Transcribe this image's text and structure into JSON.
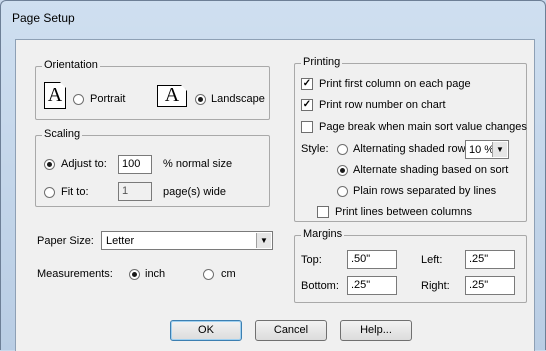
{
  "window": {
    "title": "Page Setup"
  },
  "orientation": {
    "legend": "Orientation",
    "portrait_label": "Portrait",
    "landscape_label": "Landscape",
    "icon_glyph": "A",
    "selected": "landscape"
  },
  "scaling": {
    "legend": "Scaling",
    "adjust_label": "Adjust to:",
    "adjust_value": "100",
    "adjust_suffix": "% normal size",
    "fit_label": "Fit to:",
    "fit_value": "1",
    "fit_suffix": "page(s) wide",
    "selected": "adjust"
  },
  "paper": {
    "label": "Paper Size:",
    "value": "Letter"
  },
  "measurements": {
    "label": "Measurements:",
    "inch_label": "inch",
    "cm_label": "cm",
    "selected": "inch"
  },
  "printing": {
    "legend": "Printing",
    "first_column_label": "Print first column on each page",
    "first_column_checked": true,
    "row_number_label": "Print row number on chart",
    "row_number_checked": true,
    "page_break_label": "Page break when main sort value changes",
    "page_break_checked": false,
    "style_label": "Style:",
    "alt_rows_label": "Alternating shaded rows",
    "alt_rows_value": "10 %",
    "alt_sort_label": "Alternate shading based on sort",
    "plain_rows_label": "Plain rows separated by lines",
    "style_selected": "alt_sort",
    "lines_between_label": "Print lines between columns",
    "lines_between_checked": false
  },
  "margins": {
    "legend": "Margins",
    "top_label": "Top:",
    "top_value": ".50\"",
    "left_label": "Left:",
    "left_value": ".25\"",
    "bottom_label": "Bottom:",
    "bottom_value": ".25\"",
    "right_label": "Right:",
    "right_value": ".25\""
  },
  "buttons": {
    "ok": "OK",
    "cancel": "Cancel",
    "help": "Help..."
  },
  "colors": {
    "title_bar": "#c9d9ec",
    "dialog_bg": "#f0f0f0",
    "default_button_border": "#3c7fb1"
  }
}
